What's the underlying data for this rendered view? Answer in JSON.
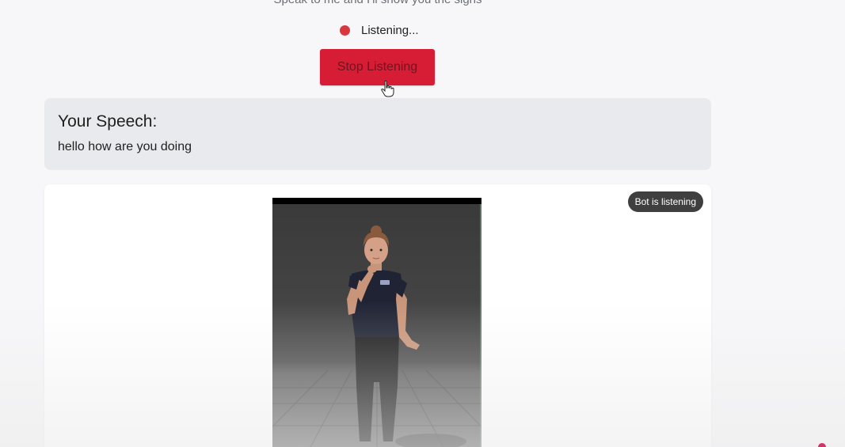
{
  "header": {
    "subtitle": "Speak to me and I'll show you the signs"
  },
  "status": {
    "text": "Listening...",
    "dot_color": "#d9363e"
  },
  "controls": {
    "stop_label": "Stop Listening",
    "stop_color": "#d61d35"
  },
  "speech": {
    "heading": "Your Speech:",
    "text": "hello how are you doing"
  },
  "avatar_panel": {
    "badge": "Bot is listening"
  }
}
